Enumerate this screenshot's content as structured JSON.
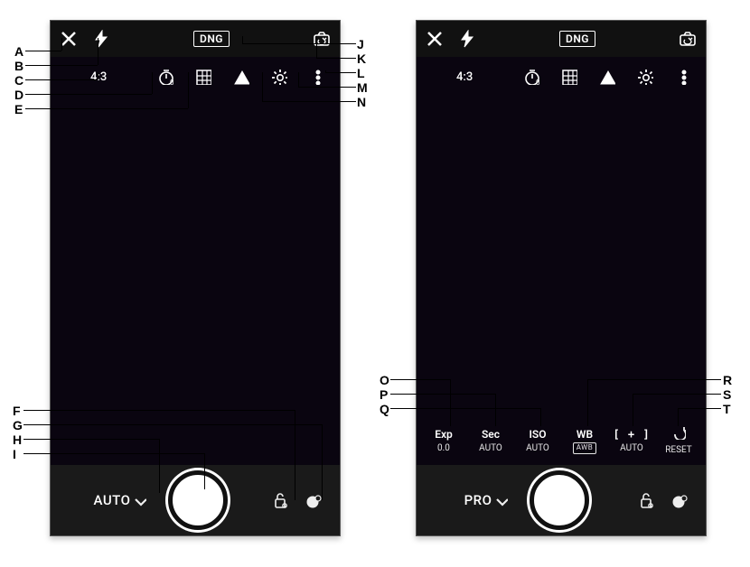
{
  "top": {
    "dng": "DNG"
  },
  "tool": {
    "ratio": "4:3"
  },
  "pro": {
    "exp": {
      "lbl": "Exp",
      "val": "0.0"
    },
    "sec": {
      "lbl": "Sec",
      "val": "AUTO"
    },
    "iso": {
      "lbl": "ISO",
      "val": "AUTO"
    },
    "wb": {
      "lbl": "WB",
      "val": "AWB"
    },
    "focus": {
      "lbl": "[ + ]",
      "val": "AUTO"
    },
    "reset": {
      "lbl": "↶",
      "val": "RESET"
    }
  },
  "bottom": {
    "mode_left": "AUTO",
    "mode_right": "PRO"
  },
  "callouts_left_top": [
    "A",
    "B",
    "C",
    "D",
    "E"
  ],
  "callouts_left_bottom": [
    "F",
    "G",
    "H",
    "I"
  ],
  "callouts_left_right": [
    "J",
    "K",
    "L",
    "M",
    "N"
  ],
  "callouts_right_left": [
    "O",
    "P",
    "Q"
  ],
  "callouts_right_right": [
    "R",
    "S",
    "T"
  ]
}
